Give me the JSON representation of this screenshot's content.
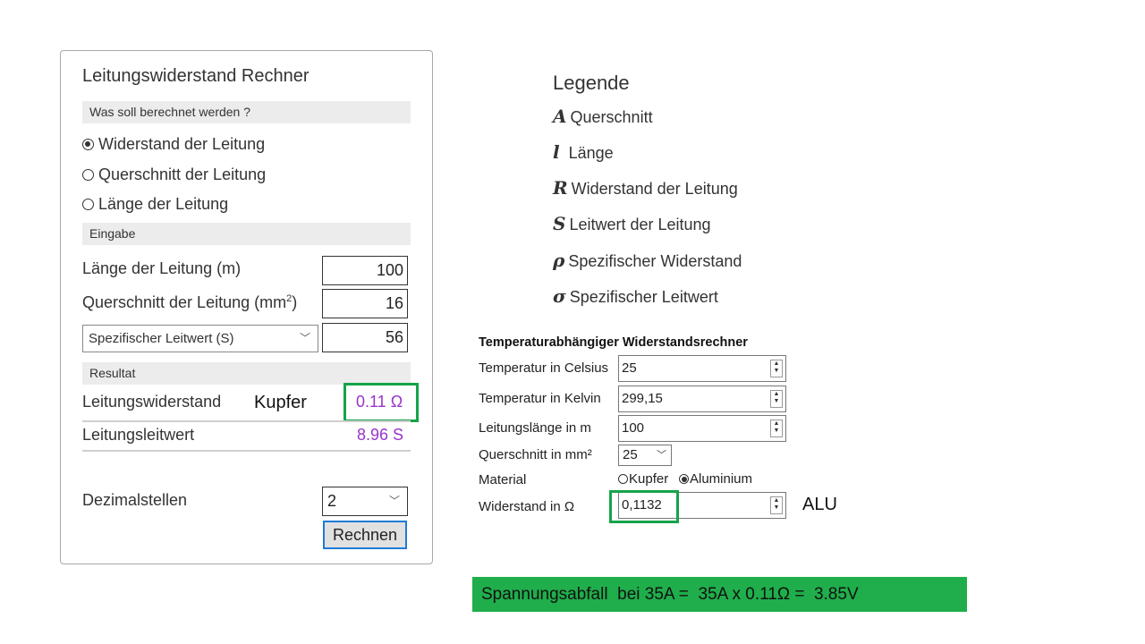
{
  "calculator": {
    "title": "Leitungswiderstand Rechner",
    "section_calc": "Was soll berechnet werden ?",
    "options": [
      {
        "label": "Widerstand der Leitung",
        "checked": true
      },
      {
        "label": "Querschnitt der Leitung",
        "checked": false
      },
      {
        "label": "Länge der Leitung",
        "checked": false
      }
    ],
    "section_input": "Eingabe",
    "length_label": "Länge der Leitung (m)",
    "length_value": "100",
    "cross_label": "Querschnitt der Leitung (mm",
    "cross_sup": "2",
    "cross_suffix": ")",
    "cross_value": "16",
    "conductance_select": "Spezifischer Leitwert (S)",
    "conductance_value": "56",
    "section_result": "Resultat",
    "resistance_label": "Leitungswiderstand",
    "resistance_value": "0.11 Ω",
    "conductance_label": "Leitungsleitwert",
    "conductance_result": "8.96 S",
    "decimals_label": "Dezimalstellen",
    "decimals_value": "2",
    "button_label": "Rechnen",
    "annotation": "Kupfer"
  },
  "legend": {
    "title": "Legende",
    "items": [
      {
        "symbol": "A",
        "text": "Querschnitt"
      },
      {
        "symbol": "l",
        "text": "Länge"
      },
      {
        "symbol": "R",
        "text": "Widerstand der Leitung"
      },
      {
        "symbol": "S",
        "text": "Leitwert der Leitung"
      },
      {
        "symbol": "ρ",
        "text": "Spezifischer Widerstand"
      },
      {
        "symbol": "σ",
        "text": "Spezifischer Leitwert"
      }
    ]
  },
  "temp_calc": {
    "title": "Temperaturabhängiger Widerstandsrechner",
    "celsius_label": "Temperatur in Celsius",
    "celsius_value": "25",
    "kelvin_label": "Temperatur in Kelvin",
    "kelvin_value": "299,15",
    "length_label": "Leitungslänge in m",
    "length_value": "100",
    "cross_label": "Querschnitt in mm²",
    "cross_value": "25",
    "material_label": "Material",
    "material_options": [
      {
        "label": "Kupfer",
        "checked": false
      },
      {
        "label": "Aluminium",
        "checked": true
      }
    ],
    "resistance_label": "Widerstand in Ω",
    "resistance_value": "0,1132",
    "annotation": "ALU"
  },
  "banner": {
    "text": "Spannungsabfall  bei 35A =  35A x 0.11Ω =  3.85V"
  },
  "colors": {
    "highlight": "#16a34a",
    "banner": "#1fae4b",
    "result": "#9933cc"
  }
}
